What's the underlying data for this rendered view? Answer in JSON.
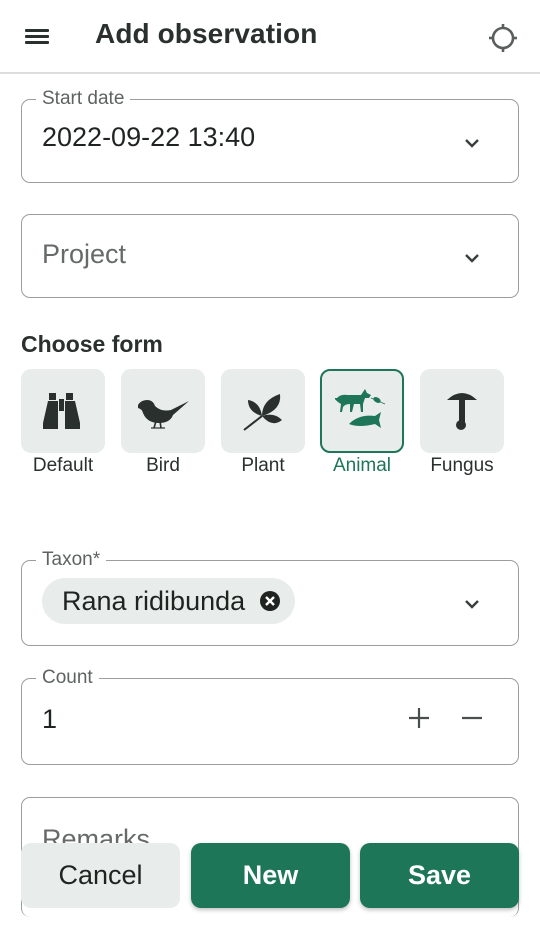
{
  "appbar": {
    "title": "Add observation",
    "menu_icon": "hamburger-menu-icon",
    "locate_icon": "gps-crosshair-icon"
  },
  "start_date": {
    "label": "Start date",
    "value": "2022-09-22 13:40"
  },
  "project": {
    "placeholder": "Project",
    "value": ""
  },
  "choose_form": {
    "title": "Choose form",
    "selected": "Animal",
    "forms": [
      {
        "label": "Default",
        "icon": "binoculars-icon"
      },
      {
        "label": "Bird",
        "icon": "bird-icon"
      },
      {
        "label": "Plant",
        "icon": "leaf-icon"
      },
      {
        "label": "Animal",
        "icon": "animal-icon"
      },
      {
        "label": "Fungus",
        "icon": "mushroom-icon"
      }
    ]
  },
  "taxon": {
    "label": "Taxon*",
    "chip": "Rana ridibunda"
  },
  "count": {
    "label": "Count",
    "value": "1"
  },
  "remarks": {
    "placeholder": "Remarks"
  },
  "actions": {
    "cancel": "Cancel",
    "new": "New",
    "save": "Save"
  },
  "colors": {
    "accent": "#1e7658",
    "tile_bg": "#e8ecea",
    "text": "#2a302d"
  }
}
